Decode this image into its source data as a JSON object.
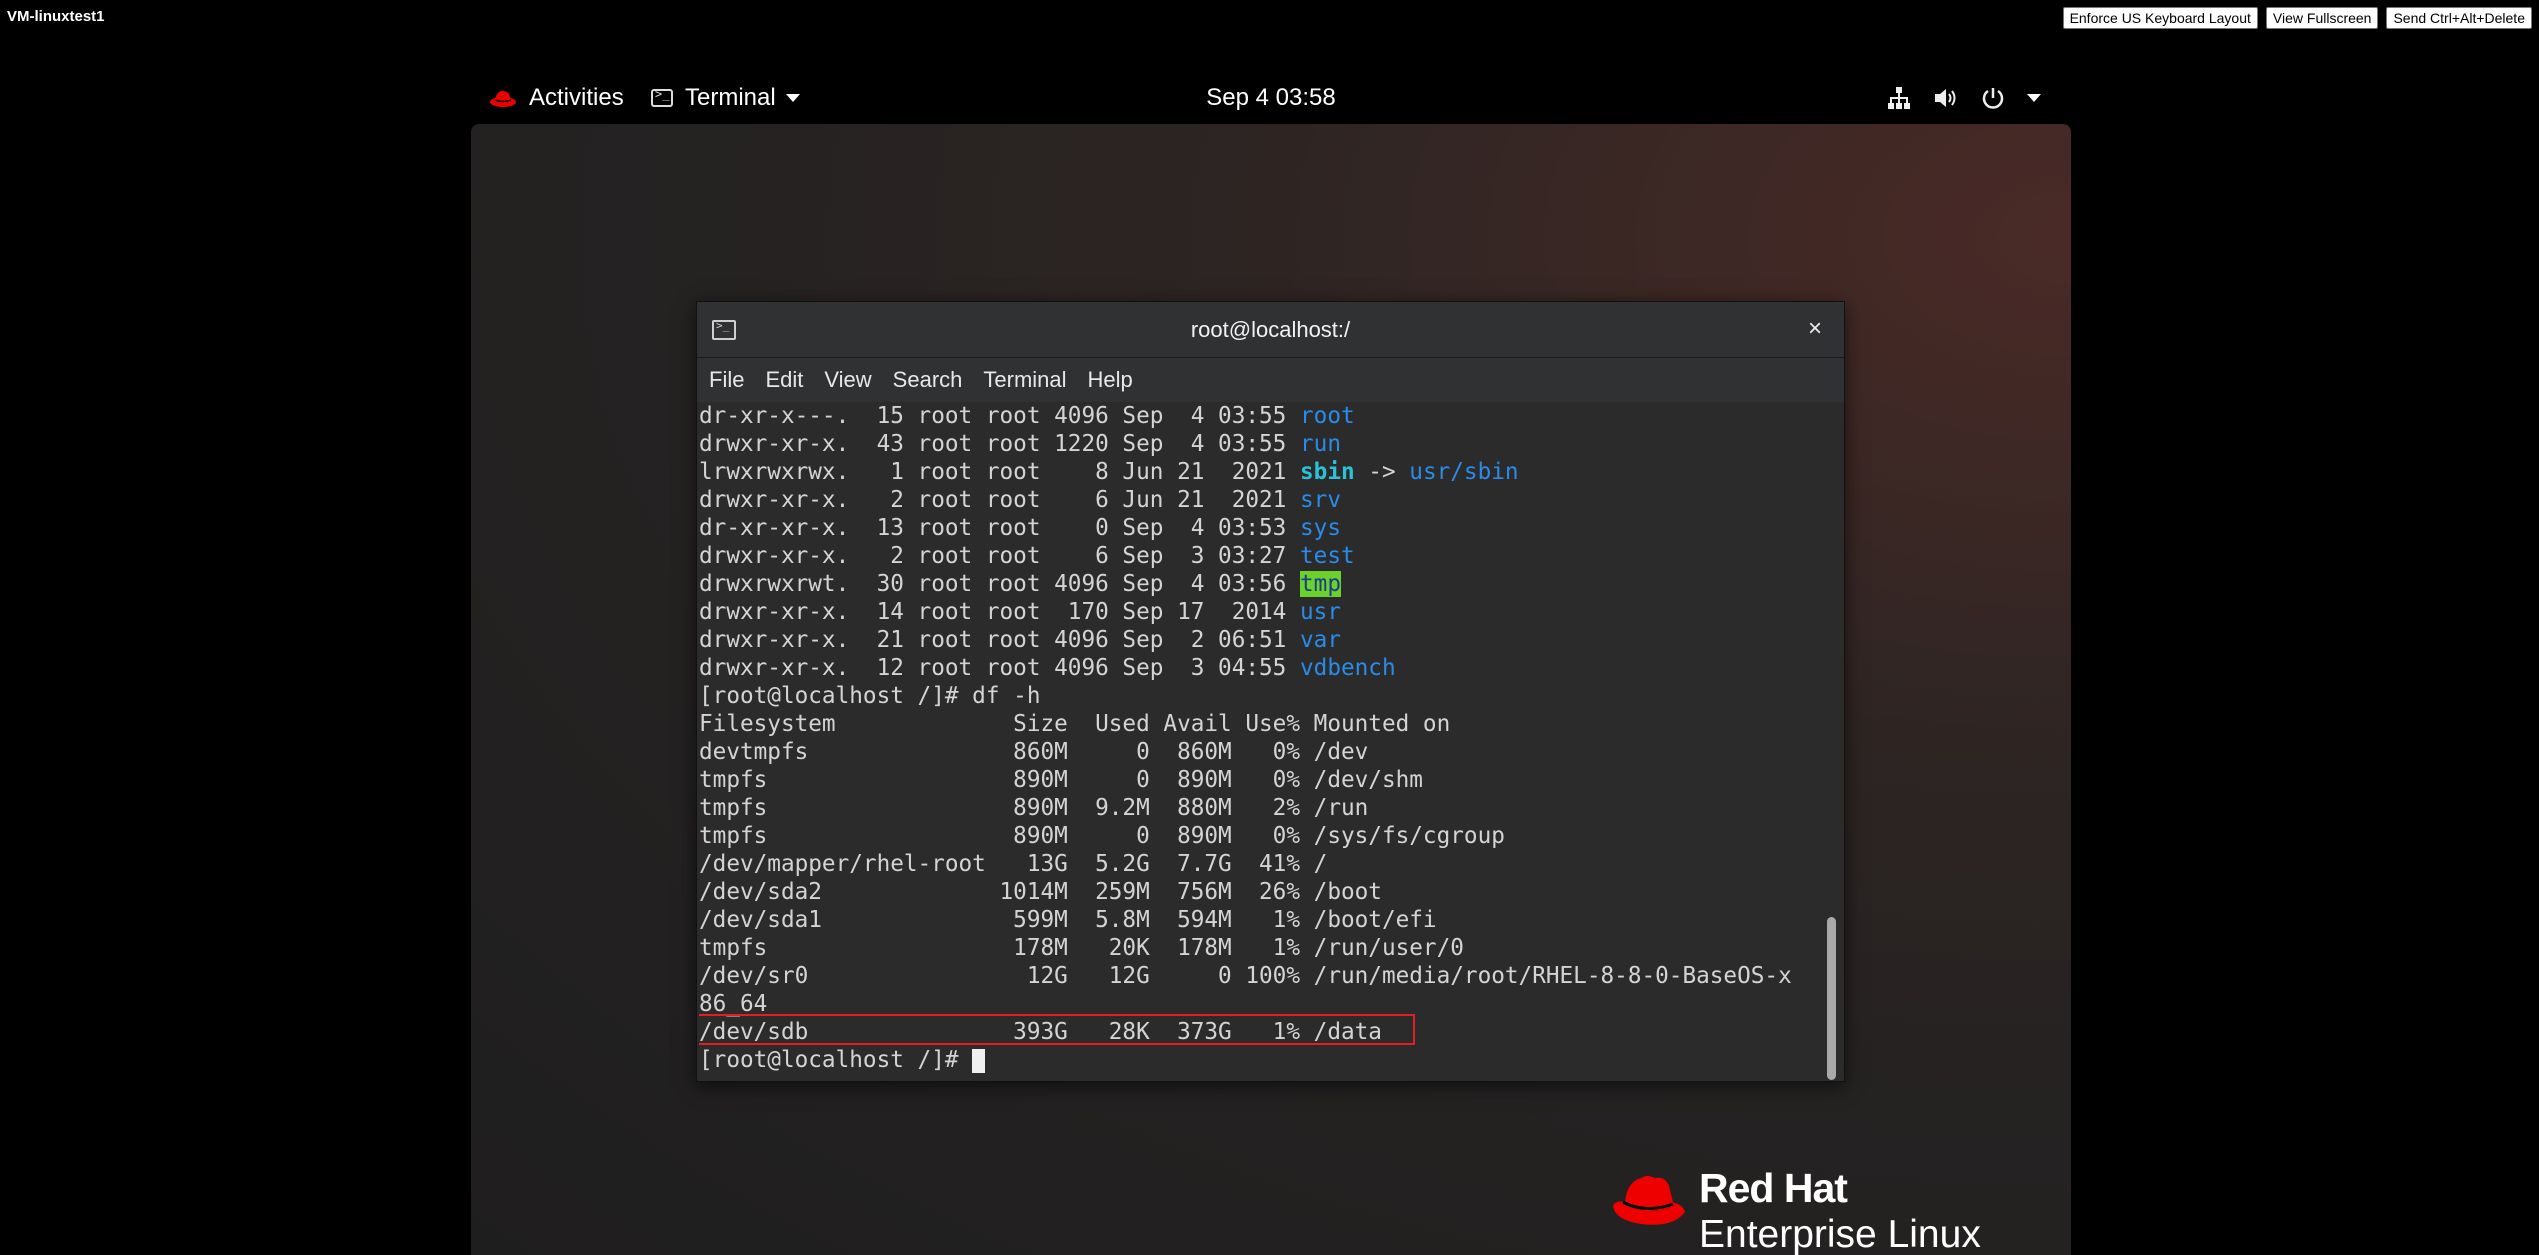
{
  "console": {
    "vm_title": "VM-linuxtest1",
    "buttons": [
      "Enforce US Keyboard Layout",
      "View Fullscreen",
      "Send Ctrl+Alt+Delete"
    ]
  },
  "topbar": {
    "activities": "Activities",
    "app_menu": "Terminal",
    "clock": "Sep 4  03:58",
    "icons": [
      "network-icon",
      "volume-icon",
      "power-icon",
      "chevron-down-icon"
    ]
  },
  "terminal": {
    "title": "root@localhost:/",
    "close": "×",
    "menu": [
      "File",
      "Edit",
      "View",
      "Search",
      "Terminal",
      "Help"
    ],
    "lines": [
      {
        "pre": "dr-xr-x---.  15 root root 4096 Sep  4 03:55 ",
        "name": "root"
      },
      {
        "pre": "drwxr-xr-x.  43 root root 1220 Sep  4 03:55 ",
        "name": "run"
      },
      {
        "pre": "lrwxrwxrwx.   1 root root    8 Jun 21  2021 ",
        "name": "sbin",
        "arrow": " -> ",
        "target": "usr/sbin"
      },
      {
        "pre": "drwxr-xr-x.   2 root root    6 Jun 21  2021 ",
        "name": "srv"
      },
      {
        "pre": "dr-xr-xr-x.  13 root root    0 Sep  4 03:53 ",
        "name": "sys"
      },
      {
        "pre": "drwxr-xr-x.   2 root root    6 Sep  3 03:27 ",
        "name": "test"
      },
      {
        "pre": "drwxrwxrwt.  30 root root 4096 Sep  4 03:56 ",
        "name": "tmp"
      },
      {
        "pre": "drwxr-xr-x.  14 root root  170 Sep 17  2014 ",
        "name": "usr"
      },
      {
        "pre": "drwxr-xr-x.  21 root root 4096 Sep  2 06:51 ",
        "name": "var"
      },
      {
        "pre": "drwxr-xr-x.  12 root root 4096 Sep  3 04:55 ",
        "name": "vdbench"
      },
      {
        "text": "[root@localhost /]# df -h"
      },
      {
        "text": "Filesystem             Size  Used Avail Use% Mounted on"
      },
      {
        "text": "devtmpfs               860M     0  860M   0% /dev"
      },
      {
        "text": "tmpfs                  890M     0  890M   0% /dev/shm"
      },
      {
        "text": "tmpfs                  890M  9.2M  880M   2% /run"
      },
      {
        "text": "tmpfs                  890M     0  890M   0% /sys/fs/cgroup"
      },
      {
        "text": "/dev/mapper/rhel-root   13G  5.2G  7.7G  41% /"
      },
      {
        "text": "/dev/sda2             1014M  259M  756M  26% /boot"
      },
      {
        "text": "/dev/sda1              599M  5.8M  594M   1% /boot/efi"
      },
      {
        "text": "tmpfs                  178M   20K  178M   1% /run/user/0"
      },
      {
        "text": "/dev/sr0                12G   12G     0 100% /run/media/root/RHEL-8-8-0-BaseOS-x"
      },
      {
        "text": "86_64"
      },
      {
        "text": "/dev/sdb               393G   28K  373G   1% /data"
      },
      {
        "text": "[root@localhost /]# "
      }
    ]
  },
  "branding": {
    "line1": "Red Hat",
    "line2": "Enterprise Linux"
  }
}
